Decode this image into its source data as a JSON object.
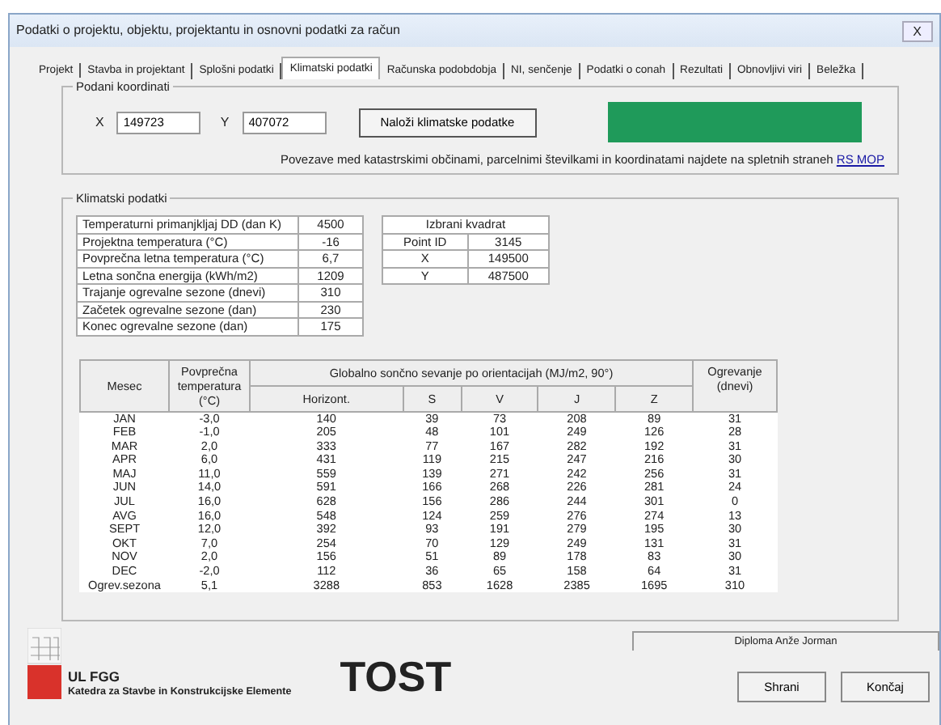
{
  "window": {
    "title": "Podatki o projektu, objektu, projektantu in osnovni podatki za račun",
    "close": "X"
  },
  "tabs": [
    {
      "label": "Projekt",
      "selected": false
    },
    {
      "label": "Stavba in projektant",
      "selected": false
    },
    {
      "label": "Splošni podatki",
      "selected": false
    },
    {
      "label": "Klimatski podatki",
      "selected": true
    },
    {
      "label": "Računska podobdobja",
      "selected": false
    },
    {
      "label": "NI, senčenje",
      "selected": false
    },
    {
      "label": "Podatki o conah",
      "selected": false
    },
    {
      "label": "Rezultati",
      "selected": false
    },
    {
      "label": "Obnovljivi viri",
      "selected": false
    },
    {
      "label": "Beležka",
      "selected": false
    }
  ],
  "coordinates": {
    "title": "Podani koordinati",
    "x_label": "X",
    "x_value": "149723",
    "y_label": "Y",
    "y_value": "407072",
    "load_button": "Naloži klimatske podatke",
    "note": "Povezave med katastrskimi občinami, parcelnimi številkami in koordinatami najdete na spletnih straneh",
    "link": "RS MOP"
  },
  "climate": {
    "title": "Klimatski podatki",
    "summary": [
      {
        "label": "Temperaturni primanjkljaj DD (dan K)",
        "value": "4500"
      },
      {
        "label": "Projektna temperatura  (°C)",
        "value": "-16"
      },
      {
        "label": "Povprečna letna temperatura (°C)",
        "value": "6,7"
      },
      {
        "label": "Letna sončna energija (kWh/m2)",
        "value": "1209"
      },
      {
        "label": "Trajanje ogrevalne sezone (dnevi)",
        "value": "310"
      },
      {
        "label": "Začetek ogrevalne sezone (dan)",
        "value": "230"
      },
      {
        "label": "Konec ogrevalne sezone (dan)",
        "value": "175"
      }
    ],
    "square": {
      "title": "Izbrani kvadrat",
      "rows": [
        {
          "label": "Point ID",
          "value": "3145"
        },
        {
          "label": "X",
          "value": "149500"
        },
        {
          "label": "Y",
          "value": "487500"
        }
      ]
    },
    "table": {
      "col_month": "Mesec",
      "col_temp": "Povprečna temperatura (°C)",
      "group": "Globalno sončno sevanje po orientacijah (MJ/m2, 90°)",
      "sub": [
        "Horizont.",
        "S",
        "V",
        "J",
        "Z"
      ],
      "col_heat": "Ogrevanje (dnevi)",
      "rows": [
        [
          "JAN",
          "-3,0",
          "140",
          "39",
          "73",
          "208",
          "89",
          "31"
        ],
        [
          "FEB",
          "-1,0",
          "205",
          "48",
          "101",
          "249",
          "126",
          "28"
        ],
        [
          "MAR",
          "2,0",
          "333",
          "77",
          "167",
          "282",
          "192",
          "31"
        ],
        [
          "APR",
          "6,0",
          "431",
          "119",
          "215",
          "247",
          "216",
          "30"
        ],
        [
          "MAJ",
          "11,0",
          "559",
          "139",
          "271",
          "242",
          "256",
          "31"
        ],
        [
          "JUN",
          "14,0",
          "591",
          "166",
          "268",
          "226",
          "281",
          "24"
        ],
        [
          "JUL",
          "16,0",
          "628",
          "156",
          "286",
          "244",
          "301",
          "0"
        ],
        [
          "AVG",
          "16,0",
          "548",
          "124",
          "259",
          "276",
          "274",
          "13"
        ],
        [
          "SEPT",
          "12,0",
          "392",
          "93",
          "191",
          "279",
          "195",
          "30"
        ],
        [
          "OKT",
          "7,0",
          "254",
          "70",
          "129",
          "249",
          "131",
          "31"
        ],
        [
          "NOV",
          "2,0",
          "156",
          "51",
          "89",
          "178",
          "83",
          "30"
        ],
        [
          "DEC",
          "-2,0",
          "112",
          "36",
          "65",
          "158",
          "64",
          "31"
        ],
        [
          "Ogrev.sezona",
          "5,1",
          "3288",
          "853",
          "1628",
          "2385",
          "1695",
          "310"
        ]
      ]
    }
  },
  "footer": {
    "credit": "Diploma Anže Jorman",
    "org_short": "UL FGG",
    "org_long": "Katedra za Stavbe in Konstrukcijske Elemente",
    "product": "TOST",
    "buttons": [
      "Shrani",
      "Končaj"
    ]
  }
}
